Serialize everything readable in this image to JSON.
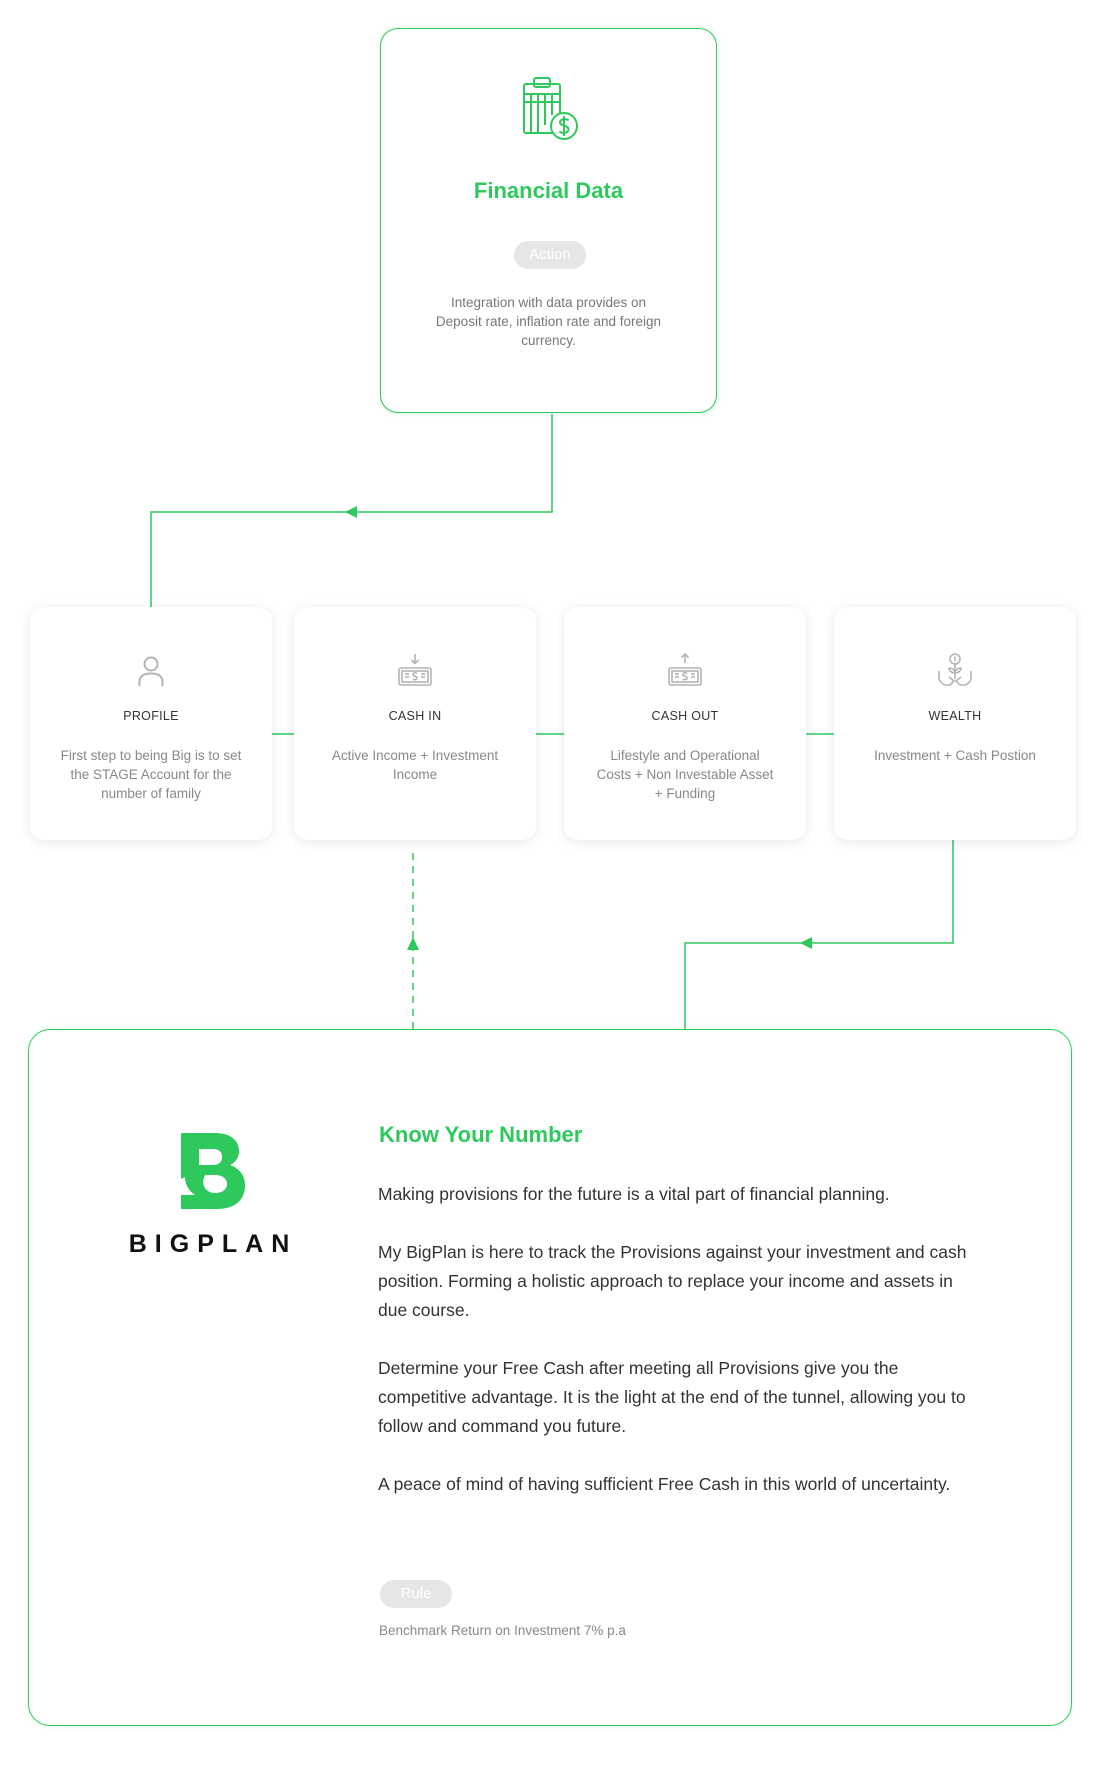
{
  "financial_data": {
    "title": "Financial Data",
    "tag": "Action",
    "description": "Integration with data provides on Deposit rate, inflation rate and foreign currency."
  },
  "steps": [
    {
      "title": "PROFILE",
      "description": "First step to being Big is to set the STAGE Account for the number of family"
    },
    {
      "title": "CASH IN",
      "description": "Active Income + Investment Income"
    },
    {
      "title": "CASH OUT",
      "description": "Lifestyle and Operational Costs + Non Investable Asset + Funding"
    },
    {
      "title": "WEALTH",
      "description": "Investment + Cash Postion"
    }
  ],
  "know_your_number": {
    "logo_text": "BIGPLAN",
    "title": "Know Your Number",
    "paragraphs": [
      "Making provisions for the future is a vital part of financial planning.",
      "My BigPlan is here to track the Provisions against your investment and cash position. Forming a holistic approach to replace your income and assets in due course.",
      "Determine your Free Cash after meeting all Provisions give you the competitive advantage. It is the light at the end of the tunnel, allowing you to follow and command you future.",
      "A peace of mind of having sufficient Free Cash in this world of uncertainty."
    ],
    "rule_tag": "Rule",
    "rule_text": "Benchmark Return on Investment 7% p.a"
  },
  "colors": {
    "accent": "#2ec95c",
    "pill_bg": "#e6e6e6",
    "icon_gray": "#b4b4b4"
  },
  "icons": {
    "financial_data": "clipboard-dollar-icon",
    "profile": "user-icon",
    "cash_in": "cash-in-icon",
    "cash_out": "cash-out-icon",
    "wealth": "hands-coin-plant-icon"
  }
}
